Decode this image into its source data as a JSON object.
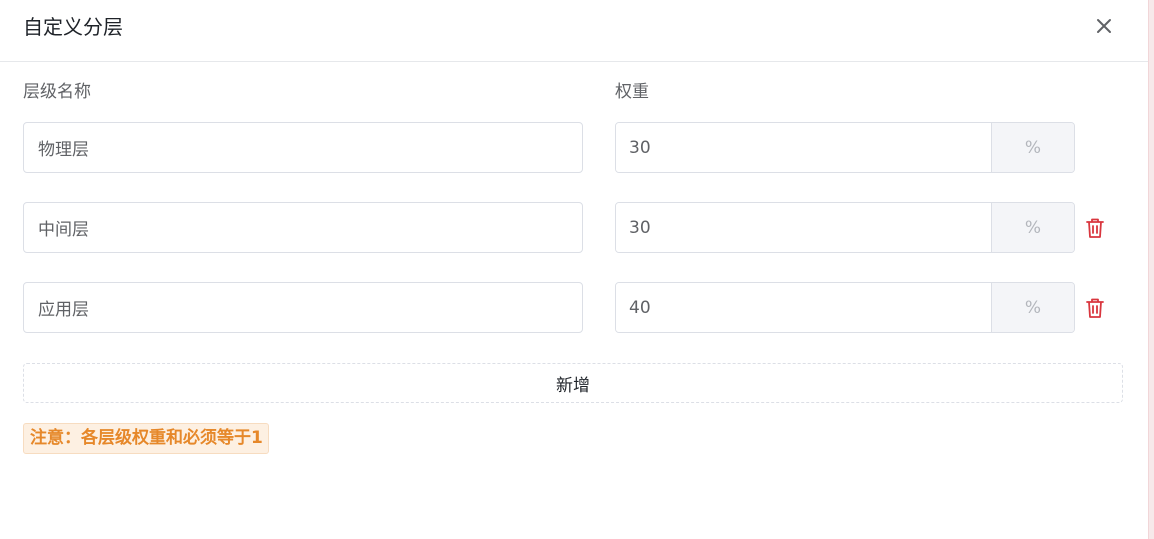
{
  "dialog": {
    "title": "自定义分层",
    "close_icon": "close-icon"
  },
  "columns": {
    "name_label": "层级名称",
    "weight_label": "权重"
  },
  "layers": [
    {
      "name": "物理层",
      "weight": "30",
      "unit": "%",
      "deletable": false
    },
    {
      "name": "中间层",
      "weight": "30",
      "unit": "%",
      "deletable": true
    },
    {
      "name": "应用层",
      "weight": "40",
      "unit": "%",
      "deletable": true
    }
  ],
  "add_button_label": "新增",
  "notice": "注意：各层级权重和必须等于1",
  "colors": {
    "delete_icon": "#d9363e",
    "notice_text": "#e6882a",
    "notice_bg": "#fdf0e2"
  }
}
